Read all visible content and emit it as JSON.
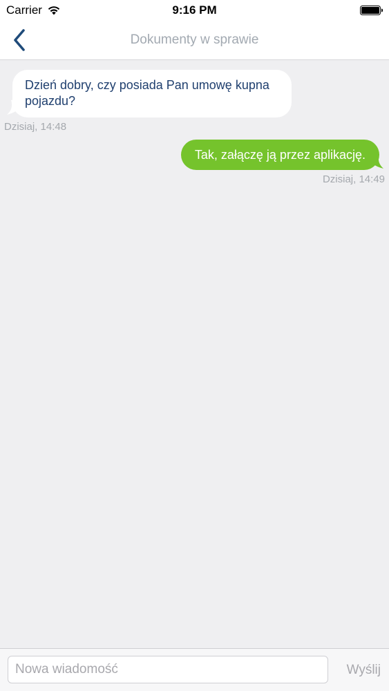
{
  "status_bar": {
    "carrier": "Carrier",
    "time": "9:16 PM"
  },
  "nav": {
    "title": "Dokumenty w sprawie",
    "back_icon": "chevron-left-icon",
    "accent_color": "#1f4b7a"
  },
  "messages": [
    {
      "direction": "incoming",
      "text": "Dzień dobry, czy posiada Pan umowę kupna pojazdu?",
      "time": "Dzisiaj, 14:48"
    },
    {
      "direction": "outgoing",
      "text": "Tak, załączę ją przez aplikację.",
      "time": "Dzisiaj, 14:49"
    }
  ],
  "composer": {
    "placeholder": "Nowa wiadomość",
    "send_label": "Wyślij"
  },
  "colors": {
    "outgoing_bubble": "#75c32c",
    "incoming_text": "#1f3f6e",
    "background": "#efeff1"
  }
}
